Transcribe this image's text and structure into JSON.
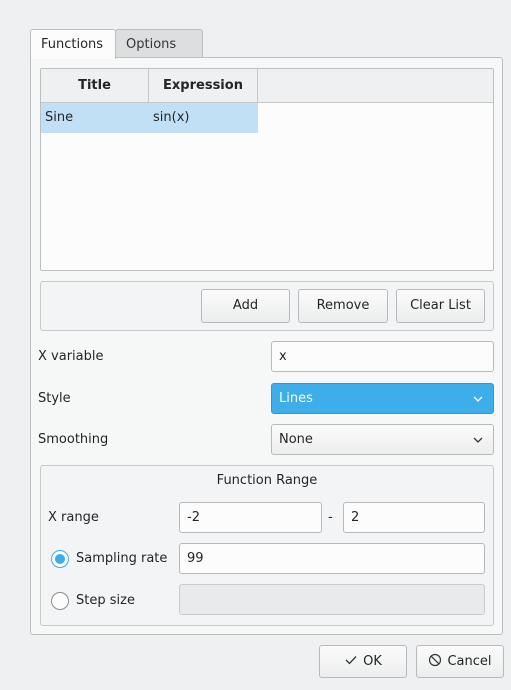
{
  "tabs": [
    {
      "label": "Functions",
      "active": true
    },
    {
      "label": "Options",
      "active": false
    }
  ],
  "table": {
    "headers": [
      "Title",
      "Expression"
    ],
    "rows": [
      {
        "title": "Sine",
        "expression": "sin(x)"
      }
    ]
  },
  "list_buttons": {
    "add": "Add",
    "remove": "Remove",
    "clear": "Clear List"
  },
  "fields": {
    "x_variable_label": "X variable",
    "x_variable_value": "x",
    "style_label": "Style",
    "style_value": "Lines",
    "smoothing_label": "Smoothing",
    "smoothing_value": "None"
  },
  "range": {
    "title": "Function Range",
    "x_range_label": "X range",
    "x_min": "-2",
    "separator": "-",
    "x_max": "2",
    "sampling_label": "Sampling rate",
    "sampling_value": "99",
    "sampling_selected": true,
    "step_label": "Step size",
    "step_value": ""
  },
  "dialog_buttons": {
    "ok": "OK",
    "cancel": "Cancel"
  },
  "colors": {
    "accent": "#3daee9",
    "selection": "#c2e0f5",
    "window": "#eff0f1"
  }
}
